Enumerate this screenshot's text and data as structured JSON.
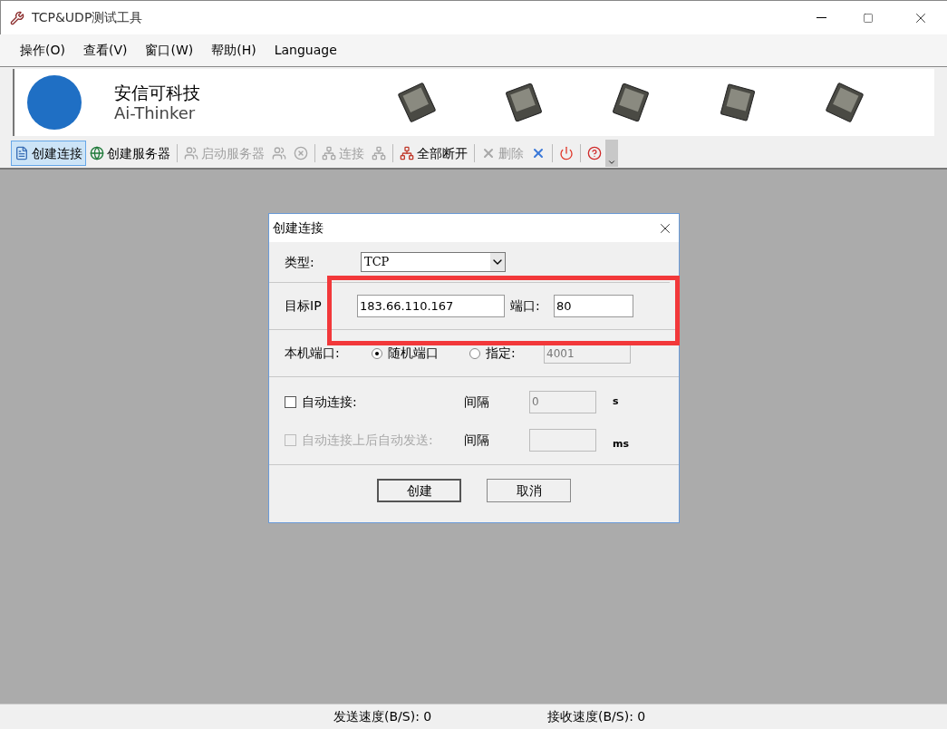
{
  "window": {
    "title": "TCP&UDP测试工具"
  },
  "menu": [
    {
      "label": "操作(O)"
    },
    {
      "label": "查看(V)"
    },
    {
      "label": "窗口(W)"
    },
    {
      "label": "帮助(H)"
    },
    {
      "label": "Language"
    }
  ],
  "banner": {
    "company": "安信可科技",
    "brand": "Ai-Thinker"
  },
  "toolbar": [
    {
      "kind": "button",
      "label": "创建连接",
      "selected": true,
      "disabled": false
    },
    {
      "kind": "button",
      "label": "创建服务器",
      "selected": false,
      "disabled": false
    },
    {
      "kind": "separator"
    },
    {
      "kind": "button",
      "label": "启动服务器",
      "selected": false,
      "disabled": true
    },
    {
      "kind": "icon",
      "selected": false,
      "disabled": true
    },
    {
      "kind": "icon",
      "selected": false,
      "disabled": true
    },
    {
      "kind": "separator"
    },
    {
      "kind": "button",
      "label": "连接",
      "selected": false,
      "disabled": true
    },
    {
      "kind": "icon",
      "selected": false,
      "disabled": true
    },
    {
      "kind": "separator"
    },
    {
      "kind": "button",
      "label": "全部断开",
      "selected": false,
      "disabled": false
    },
    {
      "kind": "separator"
    },
    {
      "kind": "button",
      "label": "删除",
      "selected": false,
      "disabled": true
    },
    {
      "kind": "icon",
      "selected": false,
      "disabled": false
    },
    {
      "kind": "separator"
    },
    {
      "kind": "icon",
      "selected": false,
      "disabled": false
    },
    {
      "kind": "separator"
    },
    {
      "kind": "icon",
      "selected": false,
      "disabled": false
    }
  ],
  "dialog": {
    "title": "创建连接",
    "type": {
      "label": "类型:",
      "value": "TCP"
    },
    "target": {
      "label": "目标IP",
      "ip": "183.66.110.167",
      "port_label": "端口:",
      "port": "80"
    },
    "local_port": {
      "label": "本机端口:",
      "options": [
        {
          "label": "随机端口",
          "selected": true
        },
        {
          "label": "指定:",
          "selected": false
        }
      ],
      "field": {
        "value": "4001",
        "disabled": true
      }
    },
    "auto_connect": {
      "label": "自动连接:",
      "checked": false,
      "disabled": false,
      "interval_label": "间隔",
      "field": {
        "value": "0",
        "disabled": true
      },
      "unit": "s"
    },
    "auto_send": {
      "label": "自动连接上后自动发送:",
      "checked": false,
      "disabled": true,
      "interval_label": "间隔",
      "field": {
        "disabled": true
      },
      "unit": "ms"
    },
    "buttons": [
      "创建",
      "取消"
    ]
  },
  "status_bar": {
    "send_speed": "发送速度(B/S): 0",
    "receive_speed": "接收速度(B/S): 0"
  }
}
